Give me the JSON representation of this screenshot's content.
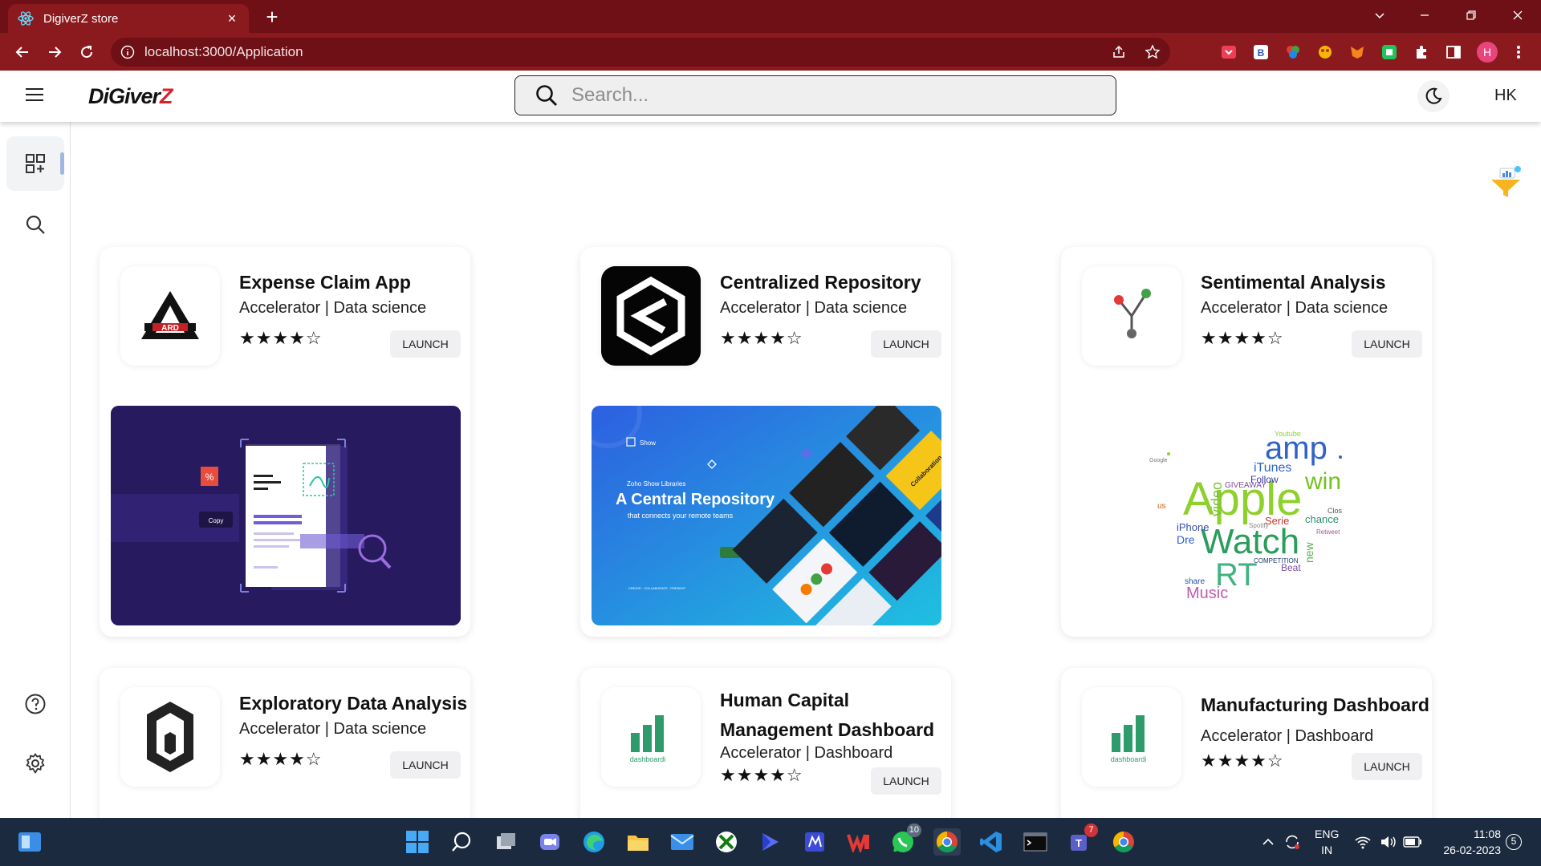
{
  "browser": {
    "tab_title": "DigiverZ store",
    "url": "localhost:3000/Application",
    "profile_initial": "H"
  },
  "header": {
    "logo_main": "DiGiver",
    "logo_accent": "Z",
    "search_placeholder": "Search...",
    "user_initials": "HK"
  },
  "apps": [
    {
      "title": "Expense Claim App",
      "category": "Accelerator | Data science",
      "rating_stars": "★★★★☆",
      "rating": 4,
      "launch_label": "LAUNCH"
    },
    {
      "title": "Centralized Repository",
      "category": "Accelerator | Data science",
      "rating_stars": "★★★★☆",
      "rating": 4,
      "launch_label": "LAUNCH"
    },
    {
      "title": "Sentimental Analysis",
      "category": "Accelerator | Data science",
      "rating_stars": "★★★★☆",
      "rating": 4,
      "launch_label": "LAUNCH"
    },
    {
      "title": "Exploratory Data Analysis",
      "category": "Accelerator | Data science",
      "rating_stars": "★★★★☆",
      "rating": 4,
      "launch_label": "LAUNCH"
    },
    {
      "title_line1": "Human Capital",
      "title_line2": "Management Dashboard",
      "category": "Accelerator | Dashboard",
      "rating_stars": "★★★★☆",
      "rating": 4,
      "launch_label": "LAUNCH"
    },
    {
      "title": "Manufacturing Dashboard",
      "category": "Accelerator | Dashboard",
      "rating_stars": "★★★★☆",
      "rating": 4,
      "launch_label": "LAUNCH"
    }
  ],
  "banners": {
    "expense_copy_label": "Copy",
    "repo_brand": "Show",
    "repo_subtitle": "Zoho Show Libraries",
    "repo_headline": "A Central Repository",
    "repo_tagline": "that connects your remote teams",
    "repo_footer": "CREATE · COLLABORATE · PRESENT",
    "repo_slide": "Collaboration",
    "wordcloud_words": [
      "amp",
      "Apple",
      "Watch",
      "RT",
      "win",
      "iTunes",
      "Follow",
      "video",
      "Music",
      "iPhone",
      "new",
      "Serie",
      "chance",
      "GIVEAWAY",
      "Youtube",
      "Beat",
      "Google",
      "COMPETITION",
      "Dre",
      "share",
      "us",
      "Spotify",
      "Retweet",
      "Clos"
    ],
    "dashboard_logo_text": "dashboardi"
  },
  "taskbar": {
    "whatsapp_badge": "10",
    "teams_badge": "7",
    "lang_line1": "ENG",
    "lang_line2": "IN",
    "time": "11:08",
    "date": "26-02-2023",
    "notifications": "5"
  },
  "colors": {
    "browser_frame": "#8b1a1f",
    "browser_tab_strip": "#6e1016",
    "logo_accent": "#d8222a",
    "taskbar": "#1c2a3f",
    "dashboard_green": "#2e9c6a"
  }
}
